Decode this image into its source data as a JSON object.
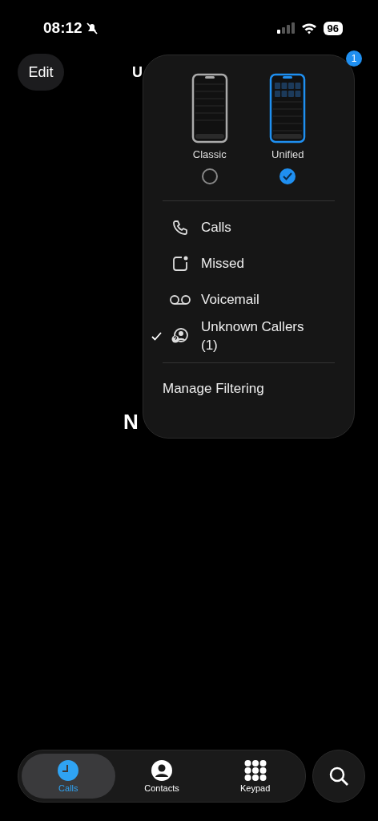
{
  "status_bar": {
    "time": "08:12",
    "silenced": true,
    "battery": "96"
  },
  "header": {
    "edit_button": "Edit",
    "title": "U",
    "badge": "1"
  },
  "empty_state": {
    "title": "N"
  },
  "menu": {
    "layouts": [
      {
        "label": "Classic",
        "kind": "classic",
        "selected": false
      },
      {
        "label": "Unified",
        "kind": "unified",
        "selected": true
      }
    ],
    "filters": [
      {
        "label": "Calls",
        "kind": "calls",
        "checked": false
      },
      {
        "label": "Missed",
        "kind": "missed",
        "checked": false
      },
      {
        "label": "Voicemail",
        "kind": "voicemail",
        "checked": false
      },
      {
        "label": "Unknown Callers (1)",
        "kind": "unknown",
        "checked": true
      }
    ],
    "footer": "Manage Filtering"
  },
  "tab_bar": {
    "tabs": [
      {
        "label": "Calls",
        "kind": "calls",
        "selected": true
      },
      {
        "label": "Contacts",
        "kind": "contacts",
        "selected": false
      },
      {
        "label": "Keypad",
        "kind": "keypad",
        "selected": false
      }
    ]
  }
}
